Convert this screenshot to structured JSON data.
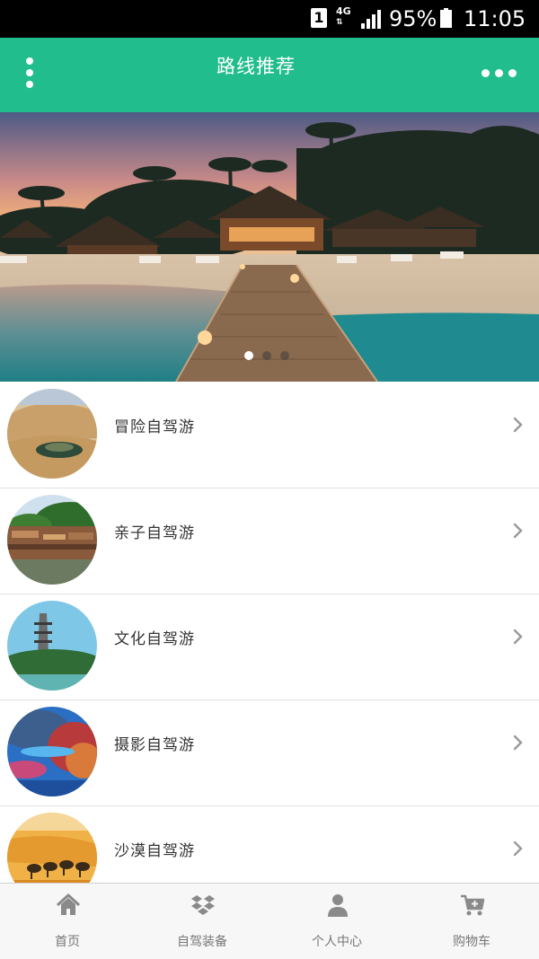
{
  "status_bar": {
    "sim": "1",
    "network": "4G",
    "battery": "95%",
    "time": "11:05"
  },
  "header": {
    "title": "路线推荐",
    "menu_icon": "vertical-dots-icon",
    "more_icon": "horizontal-dots-icon"
  },
  "banner": {
    "slide_count": 3,
    "active_slide": 1
  },
  "routes": [
    {
      "label": "冒险自驾游",
      "icon": "chevron-right-icon"
    },
    {
      "label": "亲子自驾游",
      "icon": "chevron-right-icon"
    },
    {
      "label": "文化自驾游",
      "icon": "chevron-right-icon"
    },
    {
      "label": "摄影自驾游",
      "icon": "chevron-right-icon"
    },
    {
      "label": "沙漠自驾游",
      "icon": "chevron-right-icon"
    }
  ],
  "tabbar": [
    {
      "label": "首页",
      "icon": "home-icon"
    },
    {
      "label": "自驾装备",
      "icon": "dropbox-icon"
    },
    {
      "label": "个人中心",
      "icon": "user-icon"
    },
    {
      "label": "购物车",
      "icon": "cart-plus-icon"
    }
  ],
  "colors": {
    "brand": "#22bd8c",
    "tab_icon": "#8a8a8a"
  }
}
